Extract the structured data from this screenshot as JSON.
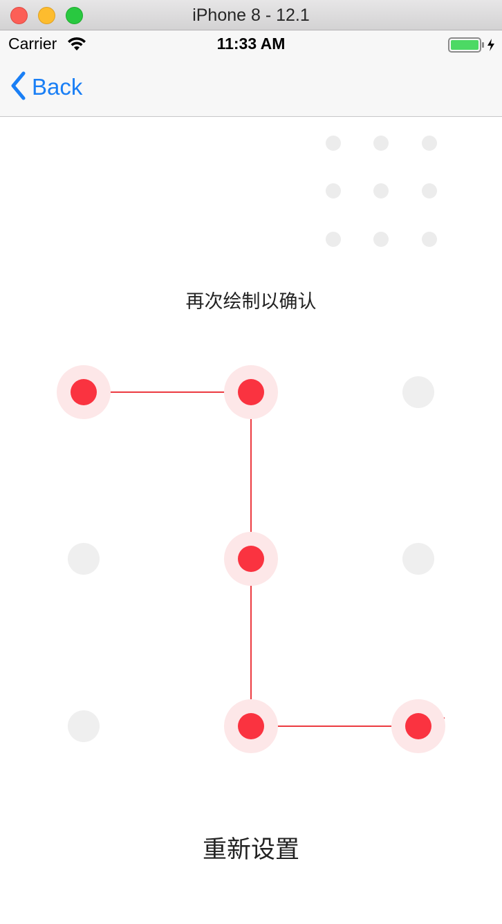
{
  "window": {
    "title": "iPhone 8 - 12.1"
  },
  "status_bar": {
    "carrier": "Carrier",
    "time": "11:33 AM",
    "wifi_icon": "wifi-icon",
    "battery_icon": "battery-charging-icon"
  },
  "nav": {
    "back_label": "Back",
    "back_icon": "chevron-left-icon"
  },
  "preview": {
    "dots": [
      false,
      false,
      false,
      false,
      false,
      false,
      false,
      false,
      false
    ]
  },
  "hint": "再次绘制以确认",
  "pattern": {
    "nodes": [
      {
        "id": 1,
        "selected": true
      },
      {
        "id": 2,
        "selected": true
      },
      {
        "id": 3,
        "selected": false
      },
      {
        "id": 4,
        "selected": false
      },
      {
        "id": 5,
        "selected": true
      },
      {
        "id": 6,
        "selected": false
      },
      {
        "id": 7,
        "selected": false
      },
      {
        "id": 8,
        "selected": true
      },
      {
        "id": 9,
        "selected": true
      }
    ],
    "path": [
      1,
      2,
      5,
      8,
      9
    ]
  },
  "reset_label": "重新设置",
  "colors": {
    "accent": "#1a7ff5",
    "selected_core": "#fa3340",
    "selected_halo": "#fde7e8",
    "line": "#ec3a40",
    "idle": "#efefef"
  }
}
